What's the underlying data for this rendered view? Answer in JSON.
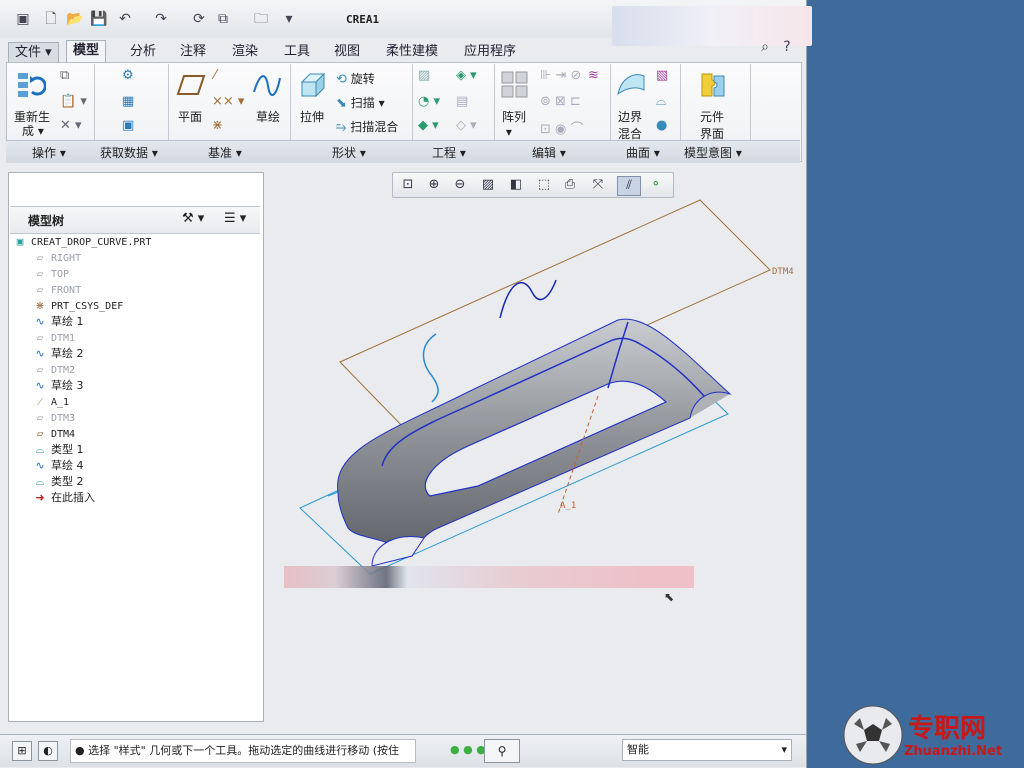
{
  "window": {
    "title": "CREA1"
  },
  "menu_tabs": [
    "文件",
    "模型",
    "分析",
    "注释",
    "渲染",
    "工具",
    "视图",
    "柔性建模",
    "应用程序"
  ],
  "ribbon": {
    "regenerate": "重新生",
    "regenerate2": "成",
    "plane": "平面",
    "sketch": "草绘",
    "extrude": "拉伸",
    "revolve": "旋转",
    "sweep": "扫描",
    "swept_blend": "扫描混合",
    "pattern": "阵列",
    "boundary1": "边界",
    "boundary2": "混合",
    "component1": "元件",
    "component2": "界面",
    "groups": [
      "操作",
      "获取数据",
      "基准",
      "形状",
      "工程",
      "编辑",
      "曲面",
      "模型意图"
    ]
  },
  "model_tree": {
    "title": "模型树",
    "root": "CREAT_DROP_CURVE.PRT",
    "items": [
      "RIGHT",
      "TOP",
      "FRONT",
      "PRT_CSYS_DEF",
      "草绘 1",
      "DTM1",
      "草绘 2",
      "DTM2",
      "草绘 3",
      "A_1",
      "DTM3",
      "DTM4",
      "类型 1",
      "草绘 4",
      "类型 2",
      "在此插入"
    ]
  },
  "viewport": {
    "dtm4_label": "DTM4",
    "axis_label": "A_1"
  },
  "status": {
    "message": "● 选择 \"样式\" 几何或下一个工具。拖动选定的曲线进行移动 (按住",
    "filter": "智能"
  },
  "watermark": {
    "cn": "专职网",
    "en": "Zhuanzhi.Net"
  },
  "colors": {
    "accent": "#1f3fbf",
    "datum": "#a0703a",
    "shade": "#8e9297"
  }
}
